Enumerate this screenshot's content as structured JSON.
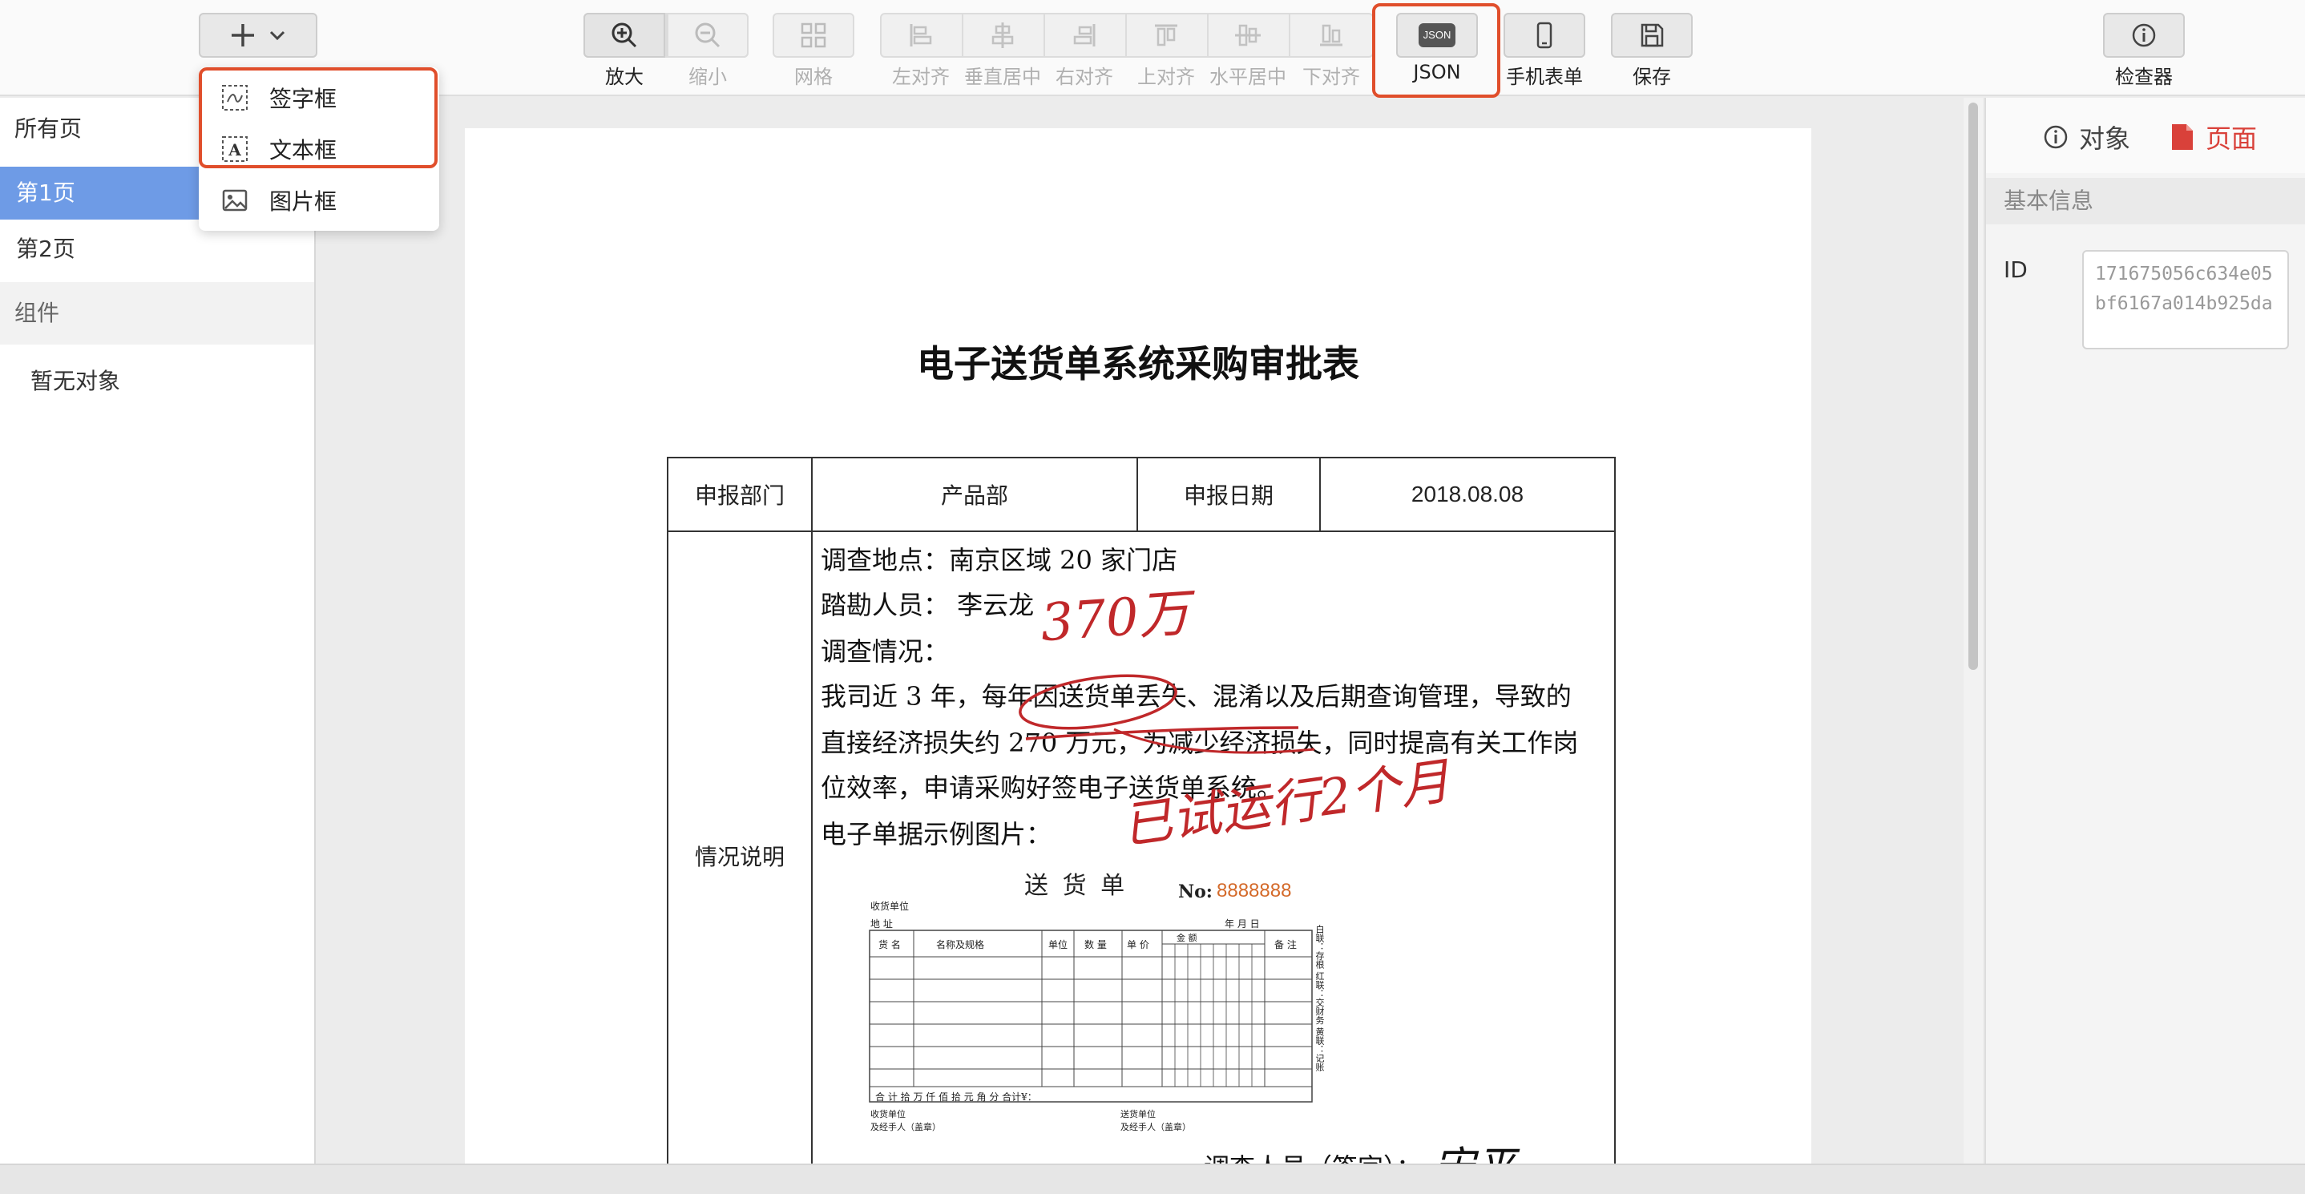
{
  "toolbar": {
    "add_button": {
      "icon": "plus-icon",
      "chevron": "chevron-down-icon"
    },
    "zoom_in": {
      "label": "放大",
      "icon": "zoom-in-icon"
    },
    "zoom_out": {
      "label": "缩小",
      "icon": "zoom-out-icon",
      "disabled": true
    },
    "grid": {
      "label": "网格",
      "icon": "grid-icon",
      "disabled": true
    },
    "align": [
      {
        "label": "左对齐",
        "icon": "align-left-icon"
      },
      {
        "label": "垂直居中",
        "icon": "align-vcenter-icon"
      },
      {
        "label": "右对齐",
        "icon": "align-right-icon"
      },
      {
        "label": "上对齐",
        "icon": "align-top-icon"
      },
      {
        "label": "水平居中",
        "icon": "align-hcenter-icon"
      },
      {
        "label": "下对齐",
        "icon": "align-bottom-icon"
      }
    ],
    "json": {
      "label": "JSON",
      "icon_text": "JSON"
    },
    "mobile_form": {
      "label": "手机表单",
      "icon": "phone-icon"
    },
    "save": {
      "label": "保存",
      "icon": "save-icon"
    },
    "inspector": {
      "label": "检查器",
      "icon": "info-icon"
    }
  },
  "dropdown": {
    "items": [
      {
        "label": "签字框",
        "icon": "signature-icon"
      },
      {
        "label": "文本框",
        "icon": "textbox-icon"
      },
      {
        "label": "图片框",
        "icon": "image-icon"
      }
    ]
  },
  "sidebar": {
    "all_pages": "所有页",
    "pages": [
      {
        "label": "第1页",
        "active": true
      },
      {
        "label": "第2页",
        "active": false
      }
    ],
    "components_header": "组件",
    "components_empty": "暂无对象"
  },
  "document": {
    "title": "电子送货单系统采购审批表",
    "row1": {
      "dept_label": "申报部门",
      "dept_value": "产品部",
      "date_label": "申报日期",
      "date_value": "2018.08.08"
    },
    "section_label": "情况说明",
    "lines": [
      "调查地点：南京区域 20 家门店",
      "踏勘人员：  李云龙",
      "调查情况：",
      "我司近 3 年，每年因送货单丢失、混淆以及后期查询管理，导致的",
      "直接经济损失约 270 万元，为减少经济损失，同时提高有关工作岗",
      "位效率，申请采购好签电子送货单系统。",
      "电子单据示例图片："
    ],
    "signature_label": "调查人员（签字）：",
    "signature_handwriting": "宋平",
    "annotations": {
      "handwriting_top": "370万",
      "handwriting_bottom": "已试运行2个月"
    },
    "receipt": {
      "title": "送 货 单",
      "no_label": "No:",
      "no_value": "8888888",
      "receiver": "收货单位",
      "address": "地    址",
      "date_labels": "年     月     日",
      "col_headers": [
        "货 名",
        "名称及规格",
        "单位",
        "数 量",
        "单 价",
        "金     额",
        "备 注"
      ],
      "money_units": [
        "十",
        "万",
        "千",
        "百",
        "十",
        "元",
        "角",
        "分"
      ],
      "total_row": "合 计     拾   万   仟   佰   拾   元   角   分     合计¥：",
      "sign_left": "收货单位\n及经手人（盖章）",
      "sign_right": "送货单位\n及经手人（盖章）",
      "side_note": "白联：存根 红联：交财务 黄联：记账"
    }
  },
  "inspector": {
    "tab_object": "对象",
    "tab_page": "页面",
    "section": "基本信息",
    "id_label": "ID",
    "id_value": "171675056c634e05bf6167a014b925da"
  },
  "colors": {
    "accent_blue": "#6e9be6",
    "highlight_red": "#e04e2b",
    "page_tab_red": "#d9413a",
    "annotation_red": "#c0282a",
    "receipt_number": "#d46a2a"
  }
}
